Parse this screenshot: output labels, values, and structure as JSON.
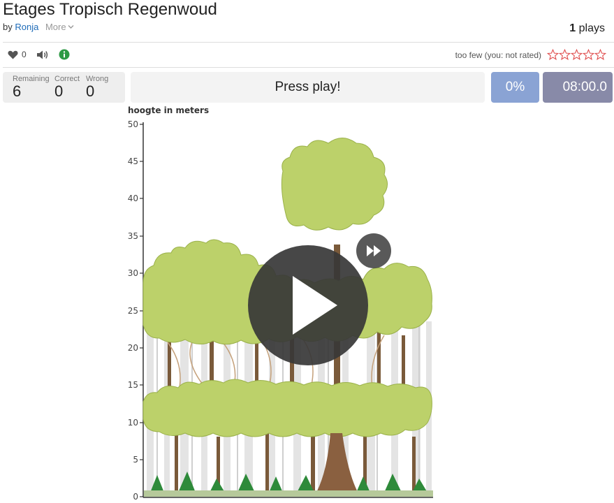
{
  "header": {
    "title": "Etages Tropisch Regenwoud",
    "by_label": "by",
    "author": "Ronja",
    "more_label": "More",
    "plays_count": "1",
    "plays_label": "plays"
  },
  "toolbar": {
    "like_count": "0",
    "icons": [
      "heart-icon",
      "speaker-icon",
      "info-icon"
    ]
  },
  "rating": {
    "text": "too few (you: not rated)",
    "stars": 5,
    "star_color": "#e05050"
  },
  "stats": {
    "remaining_label": "Remaining",
    "remaining_value": "6",
    "correct_label": "Correct",
    "correct_value": "0",
    "wrong_label": "Wrong",
    "wrong_value": "0"
  },
  "game": {
    "press_play": "Press play!",
    "percent": "0%",
    "timer": "08:00.0"
  },
  "figure": {
    "axis_title": "hoogte in meters",
    "y_ticks": [
      "50",
      "45",
      "40",
      "35",
      "30",
      "25",
      "20",
      "15",
      "10",
      "5",
      "0"
    ]
  },
  "colors": {
    "link": "#1e6bb8",
    "percent_bg": "#8aa3d4",
    "timer_bg": "#888aa8",
    "foliage": "#bcd16a",
    "trunk": "#7a5a3a"
  }
}
